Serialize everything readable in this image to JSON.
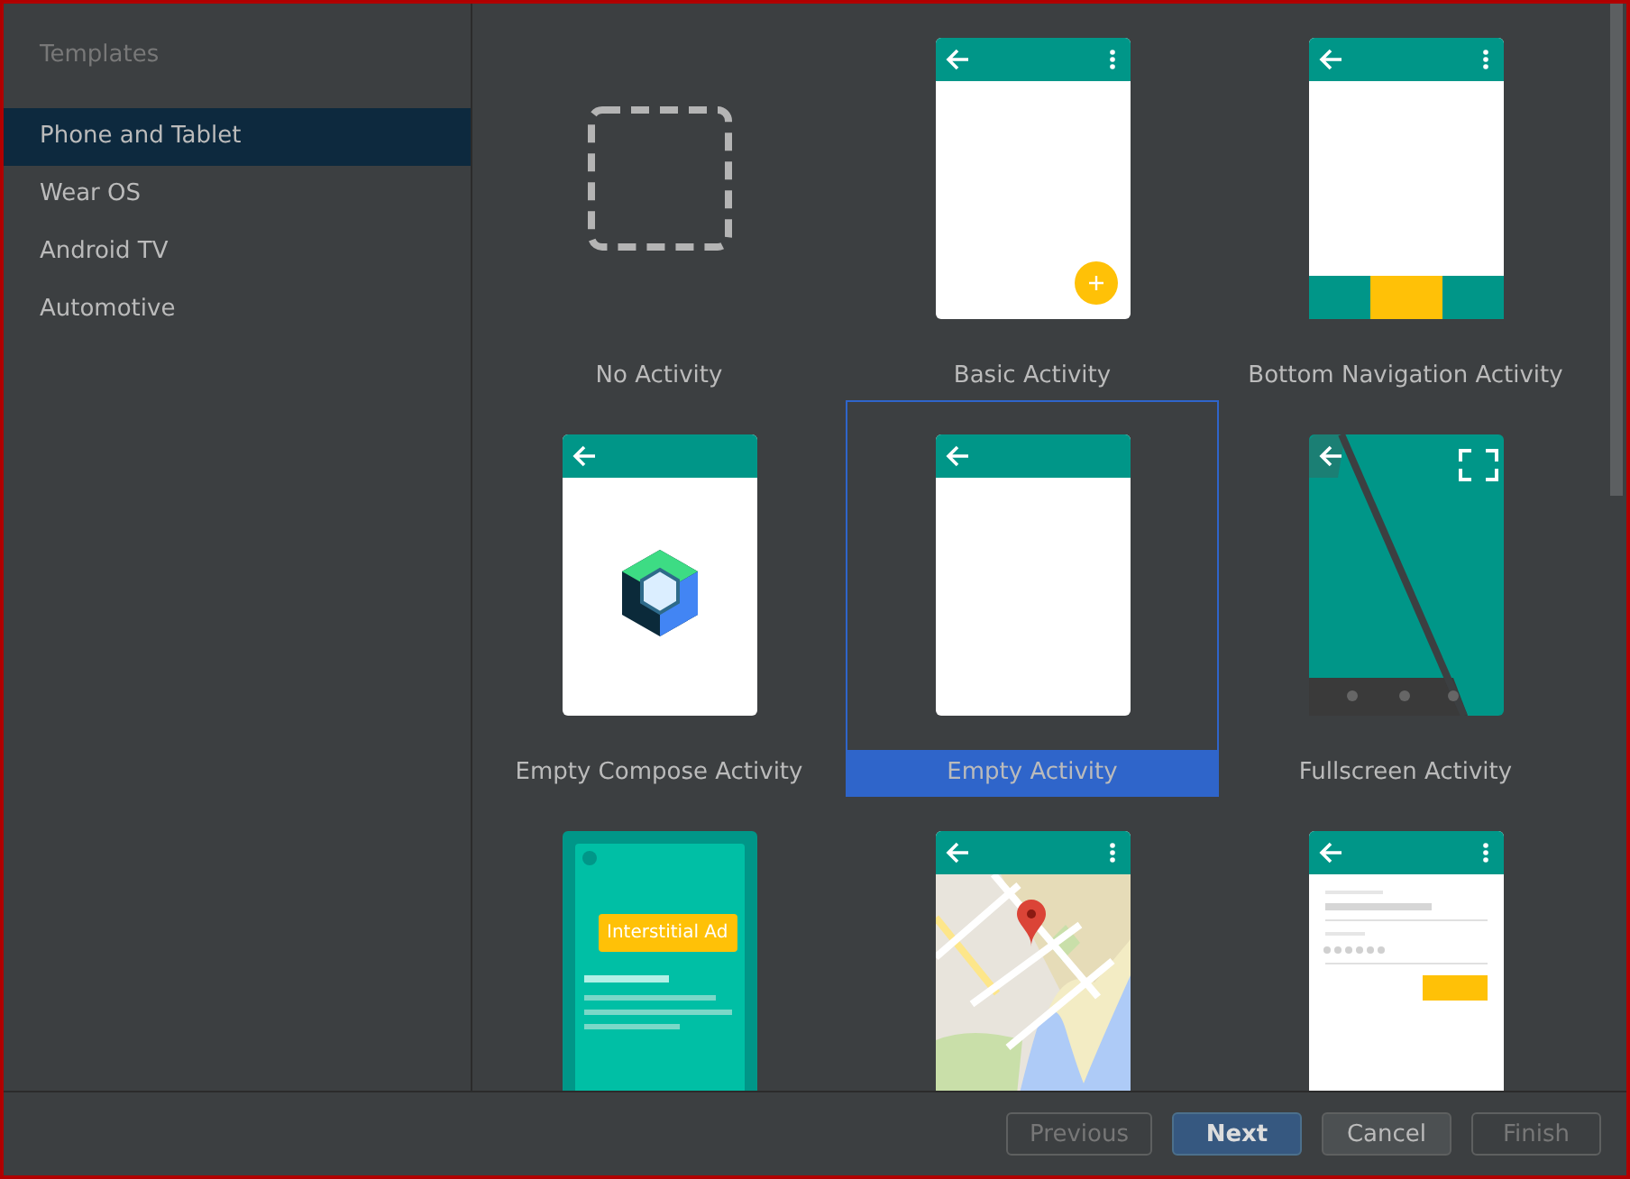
{
  "sidebar": {
    "title": "Templates",
    "items": [
      {
        "label": "Phone and Tablet",
        "selected": true
      },
      {
        "label": "Wear OS",
        "selected": false
      },
      {
        "label": "Android TV",
        "selected": false
      },
      {
        "label": "Automotive",
        "selected": false
      }
    ]
  },
  "templates": [
    {
      "kind": "none",
      "label": "No Activity",
      "selected": false
    },
    {
      "kind": "basic",
      "label": "Basic Activity",
      "selected": false
    },
    {
      "kind": "bottom_nav",
      "label": "Bottom Navigation Activity",
      "selected": false
    },
    {
      "kind": "compose",
      "label": "Empty Compose Activity",
      "selected": false
    },
    {
      "kind": "empty",
      "label": "Empty Activity",
      "selected": true
    },
    {
      "kind": "fullscreen",
      "label": "Fullscreen Activity",
      "selected": false
    },
    {
      "kind": "interstitial",
      "ad_label": "Interstitial Ad",
      "selected": false
    },
    {
      "kind": "maps",
      "selected": false
    },
    {
      "kind": "login",
      "selected": false
    }
  ],
  "buttons": [
    {
      "label": "Previous",
      "disabled": true,
      "default": false
    },
    {
      "label": "Next",
      "disabled": false,
      "default": true
    },
    {
      "label": "Cancel",
      "disabled": false,
      "default": false
    },
    {
      "label": "Finish",
      "disabled": true,
      "default": false
    }
  ]
}
